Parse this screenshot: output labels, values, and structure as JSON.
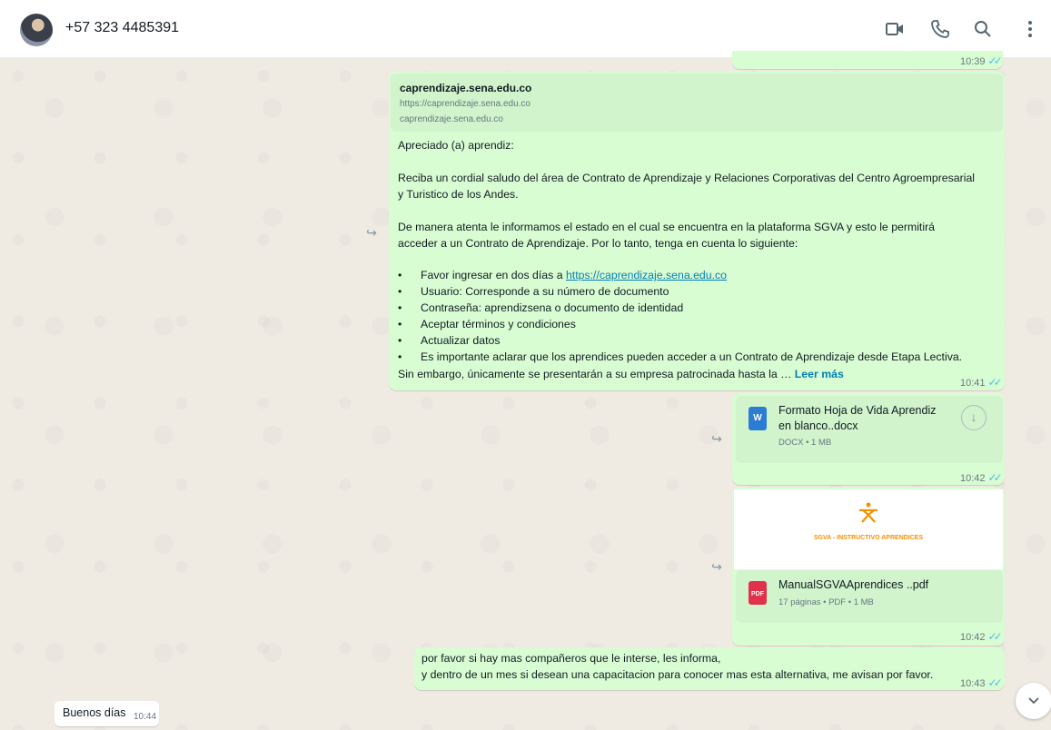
{
  "header": {
    "contact_name": "+57 323 4485391",
    "icons": [
      "video-call-icon",
      "voice-call-icon",
      "search-icon",
      "menu-icon"
    ]
  },
  "messages": {
    "prev_time": "10:39",
    "link_preview": {
      "title": "caprendizaje.sena.edu.co",
      "url": "https://caprendizaje.sena.edu.co",
      "domain": "caprendizaje.sena.edu.co"
    },
    "main": {
      "greeting": "Apreciado (a) aprendiz:",
      "para1_line1": "Reciba un cordial saludo del área de Contrato de Aprendizaje y Relaciones Corporativas del Centro Agroempresarial",
      "para1_line2": "y Turistico de los Andes.",
      "para2_line1": "De manera atenta le informamos el estado en el cual se encuentra en la plataforma SGVA y esto le permitirá",
      "para2_line2": "acceder a un Contrato de Aprendizaje.  Por lo tanto, tenga en cuenta lo siguiente:",
      "bullet_char": "•",
      "bullet1_prefix": "Favor ingresar en dos días a ",
      "bullet1_link": "https://caprendizaje.sena.edu.co",
      "bullet2": "Usuario: Corresponde a su número de documento",
      "bullet3": "Contraseña: aprendizsena o documento de identidad",
      "bullet4": "Aceptar términos y condiciones",
      "bullet5": "Actualizar datos",
      "bullet6": "Es importante aclarar que los aprendices pueden acceder a un Contrato de Aprendizaje desde Etapa Lectiva.",
      "last_line": "Sin embargo, únicamente se presentarán a su empresa patrocinada hasta la … ",
      "read_more": "Leer más",
      "time": "10:41"
    },
    "doc1": {
      "name_line1": "Formato Hoja de Vida Aprendiz",
      "name_line2": "en blanco..docx",
      "meta": "DOCX • 1 MB",
      "icon_label": "W",
      "time": "10:42"
    },
    "doc2": {
      "preview_caption": "SGVA - INSTRUCTIVO APRENDICES",
      "name": "ManualSGVAAprendices ..pdf",
      "meta": "17 páginas • PDF • 1 MB",
      "icon_label": "PDF",
      "time": "10:42"
    },
    "text_out": {
      "line1": "por favor si hay mas compañeros que le interse, les informa,",
      "line2": "y dentro de un mes si desean una capacitacion para conocer mas esta alternativa, me avisan por favor.",
      "time": "10:43"
    },
    "text_in": {
      "text": "Buenos días",
      "time": "10:44"
    }
  },
  "colors": {
    "outgoing_bubble": "#d9fdd3",
    "read_ticks": "#53bdeb",
    "link": "#027eb5",
    "sena_orange": "#f39200"
  }
}
